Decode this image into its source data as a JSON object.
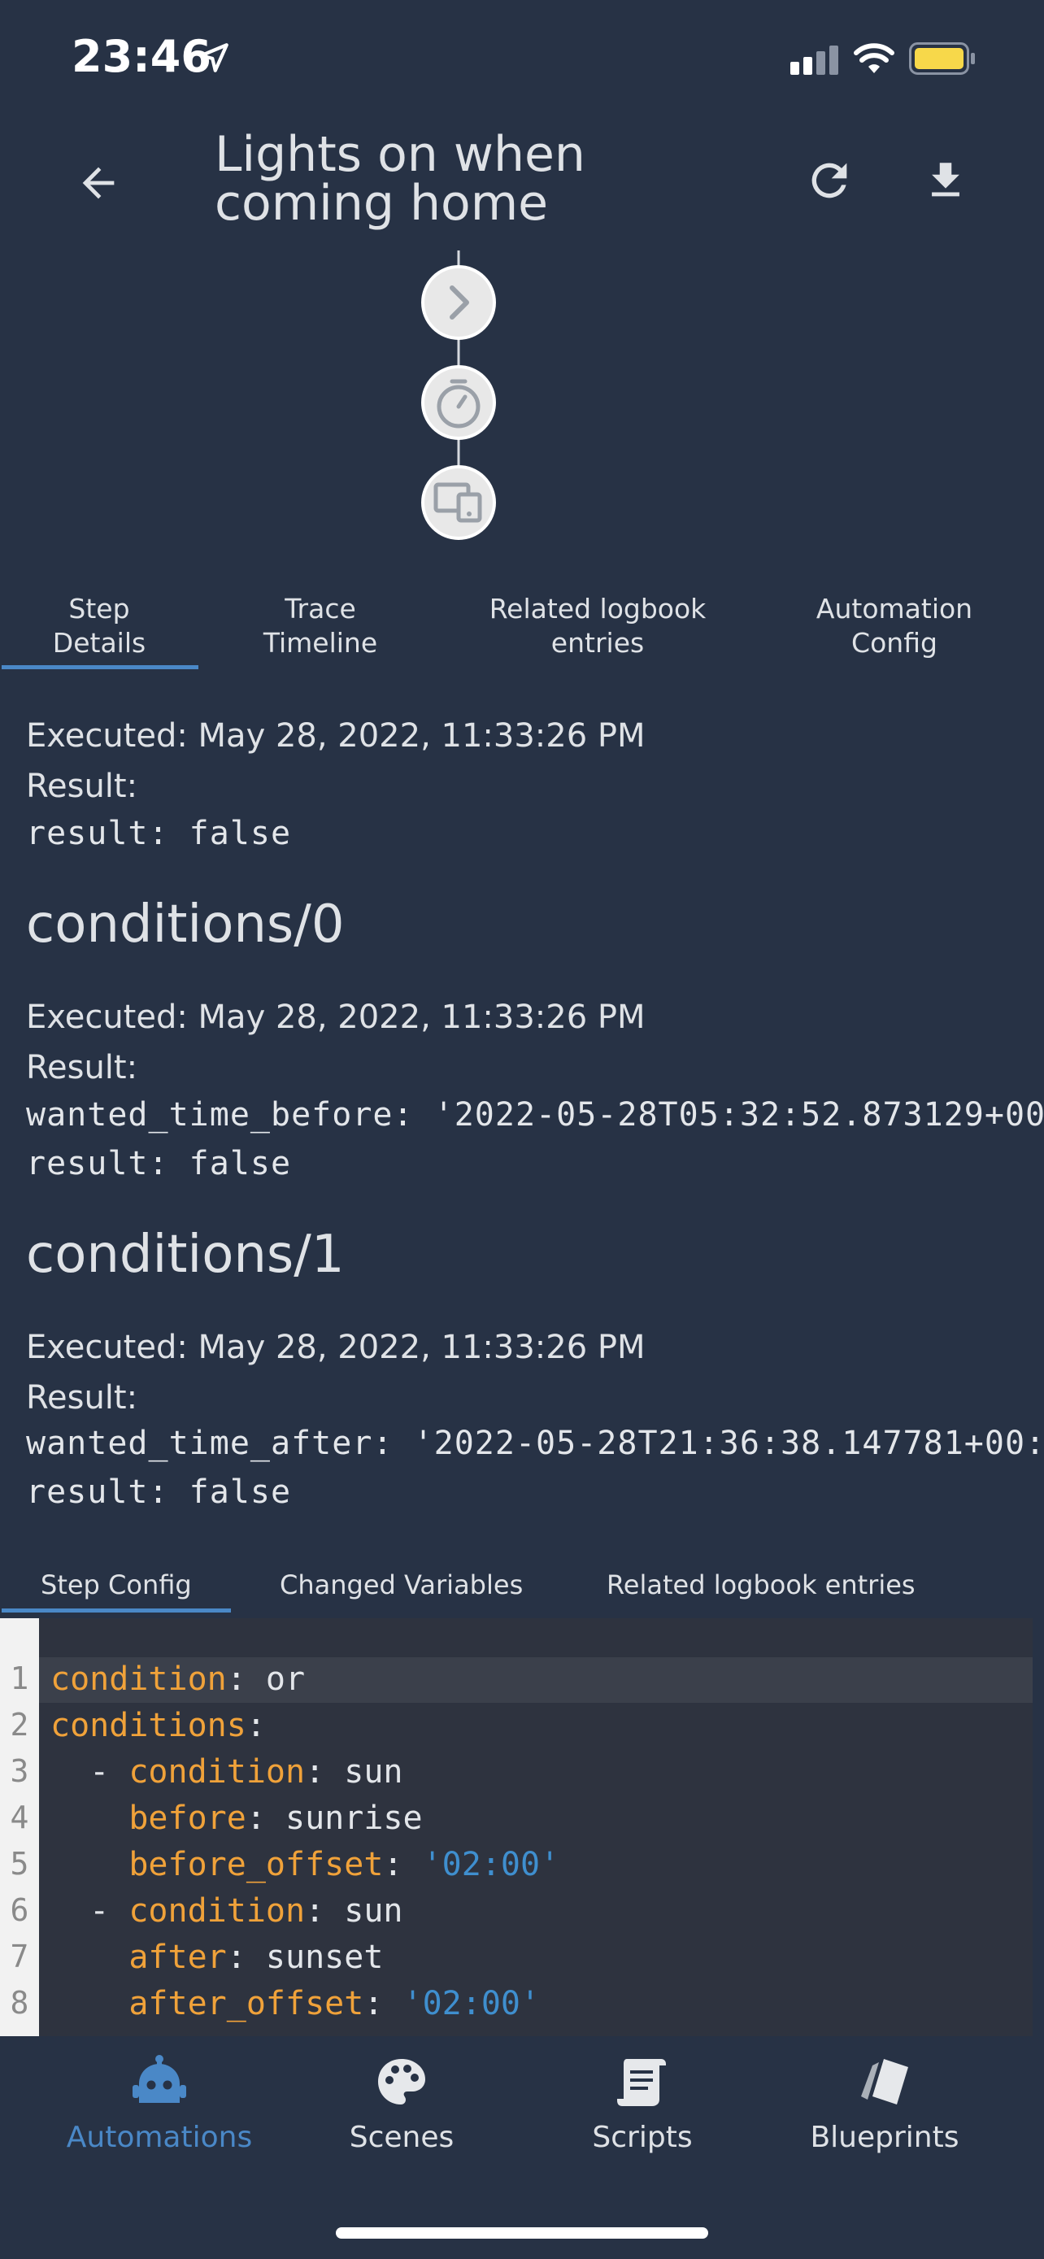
{
  "status_bar": {
    "time": "23:46"
  },
  "header": {
    "title": "Lights on when coming home"
  },
  "tabs": [
    {
      "label": "Step\nDetails"
    },
    {
      "label": "Trace\nTimeline"
    },
    {
      "label": "Related logbook\nentries"
    },
    {
      "label": "Automation\nConfig"
    }
  ],
  "details": {
    "top": {
      "executed": "Executed: May 28, 2022, 11:33:26 PM",
      "result_label": "Result:",
      "result_line": "result: false"
    },
    "conditions0": {
      "heading": "conditions/0",
      "executed": "Executed: May 28, 2022, 11:33:26 PM",
      "result_label": "Result:",
      "wanted_line": "wanted_time_before: '2022-05-28T05:32:52.873129+00",
      "result_line": "result: false"
    },
    "conditions1": {
      "heading": "conditions/1",
      "executed": "Executed: May 28, 2022, 11:33:26 PM",
      "result_label": "Result:",
      "wanted_line": "wanted_time_after: '2022-05-28T21:36:38.147781+00:",
      "result_line": "result: false"
    }
  },
  "sub_tabs": [
    {
      "label": "Step Config"
    },
    {
      "label": "Changed Variables"
    },
    {
      "label": "Related logbook entries"
    }
  ],
  "code": {
    "line_numbers": [
      "1",
      "2",
      "3",
      "4",
      "5",
      "6",
      "7",
      "8"
    ],
    "l1": {
      "key": "condition",
      "val": "or"
    },
    "l2": {
      "key": "conditions"
    },
    "l3": {
      "dash": "- ",
      "key": "condition",
      "val": "sun"
    },
    "l4": {
      "key": "before",
      "val": "sunrise"
    },
    "l5": {
      "key": "before_offset",
      "str": "'02:00'"
    },
    "l6": {
      "dash": "- ",
      "key": "condition",
      "val": "sun"
    },
    "l7": {
      "key": "after",
      "val": "sunset"
    },
    "l8": {
      "key": "after_offset",
      "str": "'02:00'"
    }
  },
  "bottom_nav": [
    {
      "label": "Automations",
      "icon": "robot-icon",
      "active": true
    },
    {
      "label": "Scenes",
      "icon": "palette-icon",
      "active": false
    },
    {
      "label": "Scripts",
      "icon": "script-icon",
      "active": false
    },
    {
      "label": "Blueprints",
      "icon": "blueprint-icon",
      "active": false
    }
  ],
  "colors": {
    "background": "#273245",
    "accent": "#4a88c7",
    "code_key": "#f0a23a",
    "code_string": "#3f8fcf"
  }
}
